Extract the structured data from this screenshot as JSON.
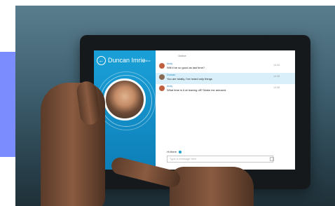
{
  "contact": {
    "name": "Duncan Imrie",
    "status": "online"
  },
  "chat": {
    "day_label": "Online",
    "messages": [
      {
        "sender": "Andy",
        "text": "Will it be so good as last time?",
        "time": "14:34",
        "highlighted": false
      },
      {
        "sender": "Duncan",
        "text": "You are totally, I've heard only things",
        "time": "14:35",
        "highlighted": true
      },
      {
        "sender": "Andy",
        "text": "What time is it at leaving off? Make me amused.",
        "time": "14:36",
        "highlighted": false
      }
    ],
    "typing_label": "Hi there",
    "compose_placeholder": "Type a message here"
  },
  "colors": {
    "accent_panel": "#7b8cff",
    "skype_blue": "#1aa0d8",
    "highlight_row": "#d9f0fb"
  }
}
